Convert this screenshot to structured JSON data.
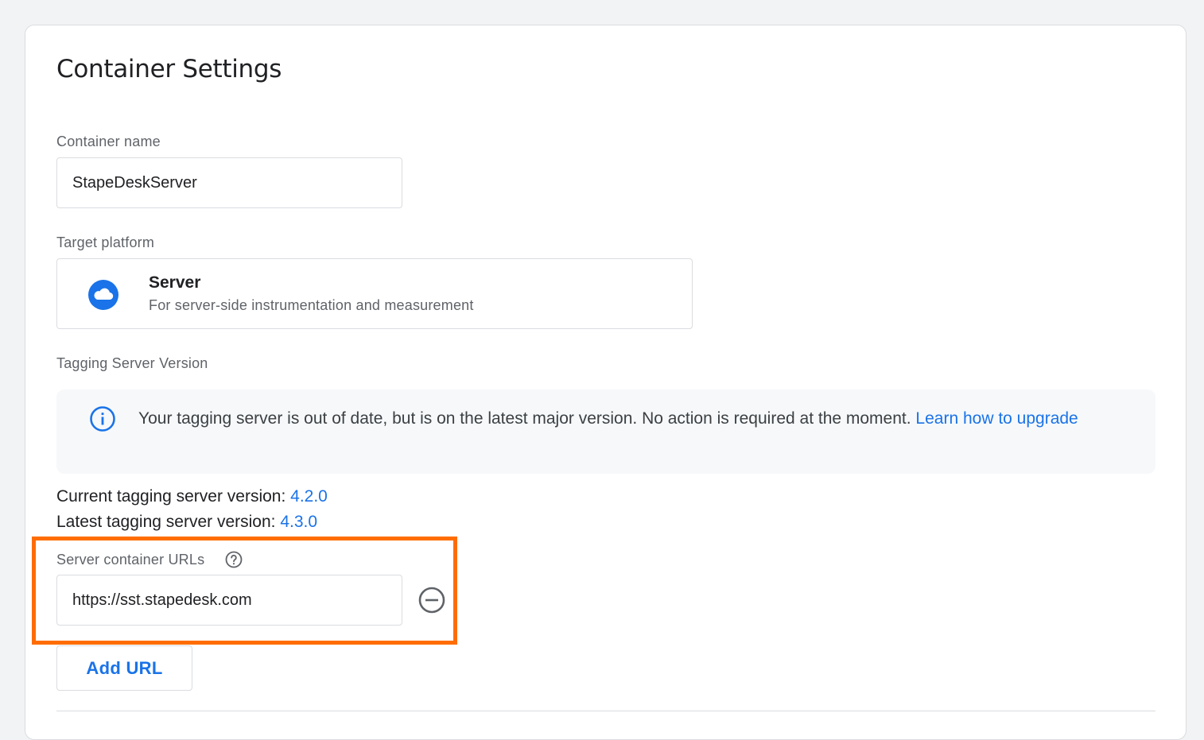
{
  "page": {
    "title": "Container Settings"
  },
  "container_name": {
    "label": "Container name",
    "value": "StapeDeskServer"
  },
  "target_platform": {
    "label": "Target platform",
    "name": "Server",
    "description": "For server-side instrumentation and measurement",
    "icon": "cloud-icon",
    "icon_color": "#1a73e8"
  },
  "tagging_server": {
    "label": "Tagging Server Version",
    "notice_text": "Your tagging server is out of date, but is on the latest major version. No action is required at the moment. ",
    "notice_link": "Learn how to upgrade",
    "notice_icon": "info-icon",
    "current_label": "Current tagging server version: ",
    "current_value": "4.2.0",
    "latest_label": "Latest tagging server version: ",
    "latest_value": "4.3.0"
  },
  "server_urls": {
    "label": "Server container URLs",
    "help_icon": "help-icon",
    "url_value": "https://sst.stapedesk.com",
    "remove_icon": "remove-circle-icon",
    "add_button": "Add URL",
    "highlight_color": "#ff6d00"
  },
  "colors": {
    "link": "#1a73e8",
    "background": "#f1f3f4"
  }
}
